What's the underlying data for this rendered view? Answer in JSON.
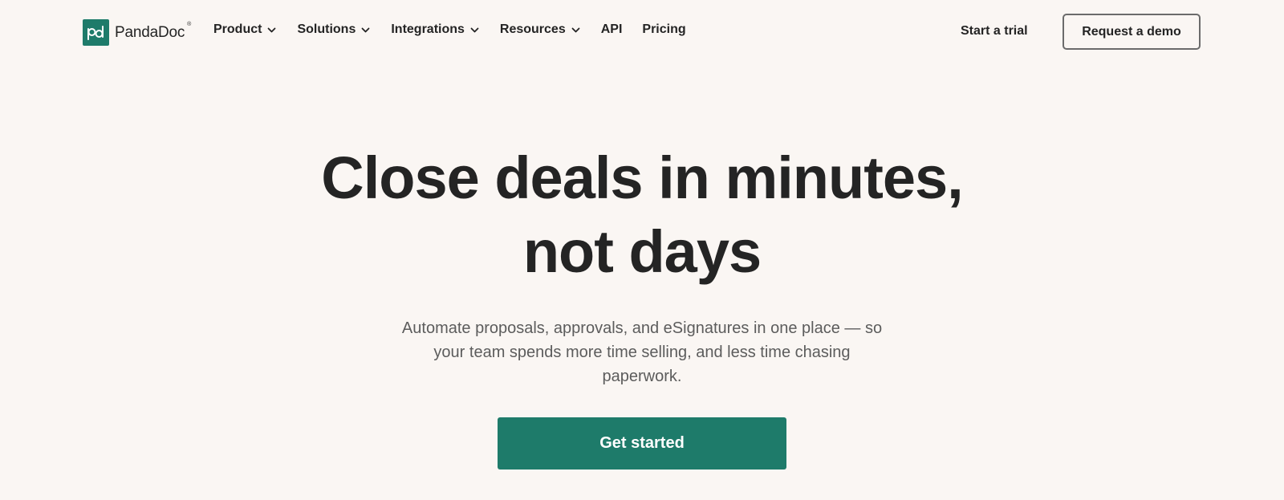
{
  "brand": {
    "name": "PandaDoc",
    "registered_mark": "®",
    "logo_icon": "pandadoc-logo-icon",
    "color": "#1e7b6a"
  },
  "nav": {
    "items": [
      {
        "label": "Product",
        "has_dropdown": true,
        "icon": "chevron-down-icon"
      },
      {
        "label": "Solutions",
        "has_dropdown": true,
        "icon": "chevron-down-icon"
      },
      {
        "label": "Integrations",
        "has_dropdown": true,
        "icon": "chevron-down-icon"
      },
      {
        "label": "Resources",
        "has_dropdown": true,
        "icon": "chevron-down-icon"
      },
      {
        "label": "API",
        "has_dropdown": false
      },
      {
        "label": "Pricing",
        "has_dropdown": false
      }
    ],
    "start_trial": "Start a trial",
    "request_demo": "Request a demo"
  },
  "hero": {
    "title_line1": "Close deals in minutes,",
    "title_line2": "not days",
    "subtitle_line1": "Automate proposals, approvals, and eSignatures in one place — so",
    "subtitle_line2": "your team spends more time selling, and less time chasing",
    "subtitle_line3": "paperwork.",
    "cta_label": "Get started"
  },
  "colors": {
    "background": "#faf6f3",
    "accent": "#1e7b6a",
    "text": "#242424",
    "muted_text": "#5c5c5c"
  }
}
